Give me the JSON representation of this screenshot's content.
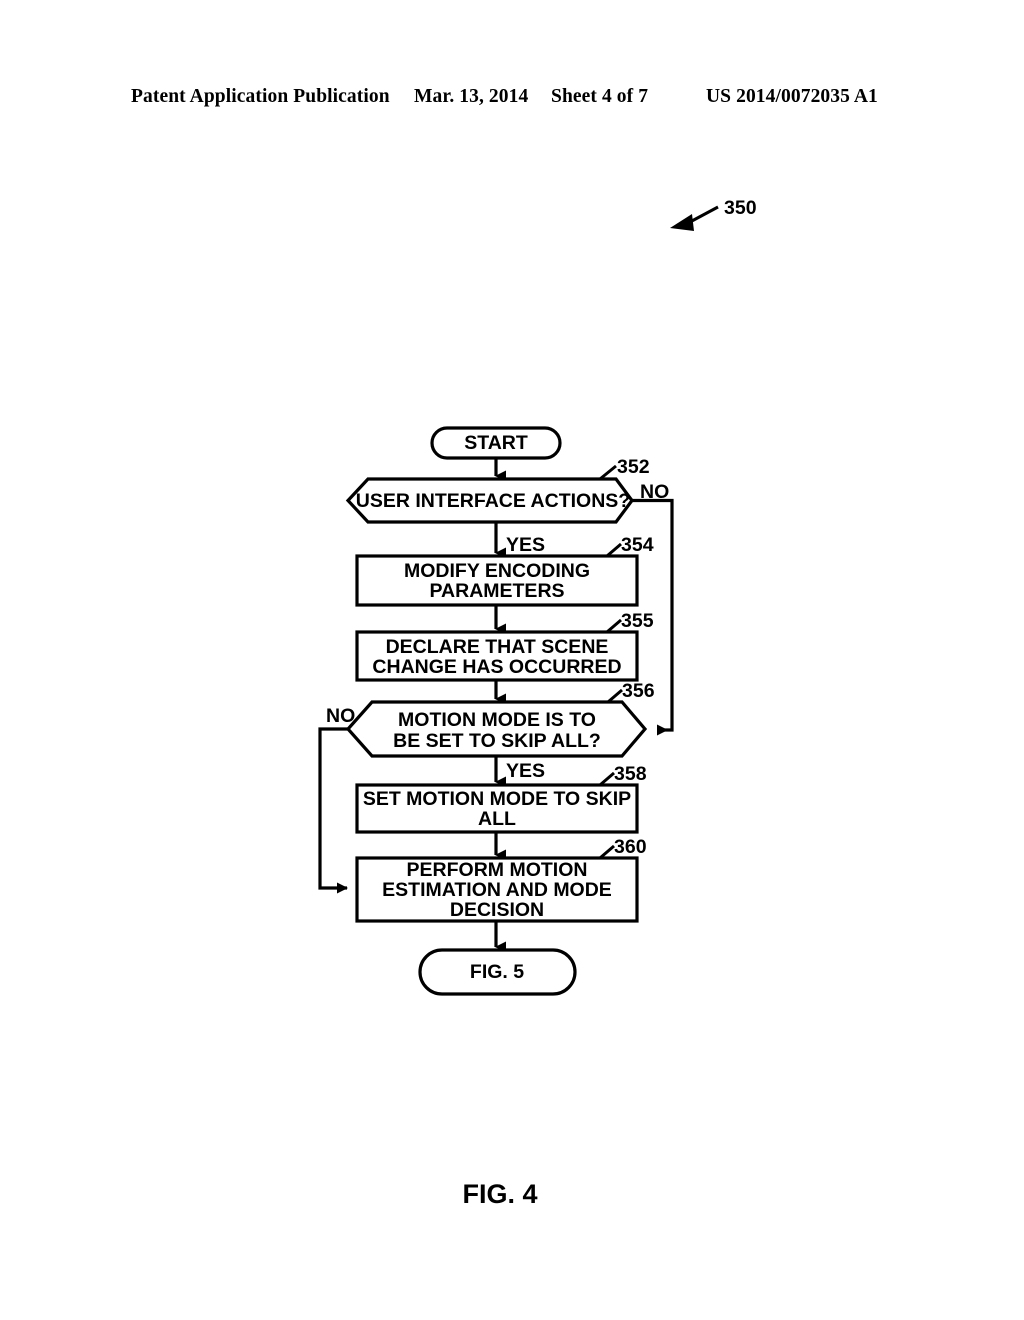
{
  "header": {
    "publication": "Patent Application Publication",
    "date": "Mar. 13, 2014",
    "sheet": "Sheet 4 of 7",
    "patent_number": "US 2014/0072035 A1"
  },
  "figure": {
    "caption": "FIG. 4",
    "diagram_reference": "350",
    "stroke_color": "#000000",
    "fill_color": "#ffffff"
  },
  "flowchart": {
    "nodes": [
      {
        "id": "start",
        "ref": "",
        "shape": "terminator",
        "lines": [
          "START"
        ]
      },
      {
        "id": "d352",
        "ref": "352",
        "shape": "decision",
        "lines": [
          "USER INTERFACE ACTIONS?"
        ]
      },
      {
        "id": "p354",
        "ref": "354",
        "shape": "process",
        "lines": [
          "MODIFY ENCODING",
          "PARAMETERS"
        ]
      },
      {
        "id": "p355",
        "ref": "355",
        "shape": "process",
        "lines": [
          "DECLARE THAT SCENE",
          "CHANGE HAS OCCURRED"
        ]
      },
      {
        "id": "d356",
        "ref": "356",
        "shape": "decision",
        "lines": [
          "MOTION MODE IS TO",
          "BE SET TO SKIP ALL?"
        ]
      },
      {
        "id": "p358",
        "ref": "358",
        "shape": "process",
        "lines": [
          "SET MOTION MODE TO SKIP",
          "ALL"
        ]
      },
      {
        "id": "p360",
        "ref": "360",
        "shape": "process",
        "lines": [
          "PERFORM MOTION",
          "ESTIMATION AND MODE",
          "DECISION"
        ]
      },
      {
        "id": "end",
        "ref": "",
        "shape": "terminator",
        "lines": [
          "FIG. 5"
        ]
      }
    ],
    "branch_labels": {
      "d352_no": "NO",
      "d352_yes": "YES",
      "d356_no": "NO",
      "d356_yes": "YES"
    }
  }
}
